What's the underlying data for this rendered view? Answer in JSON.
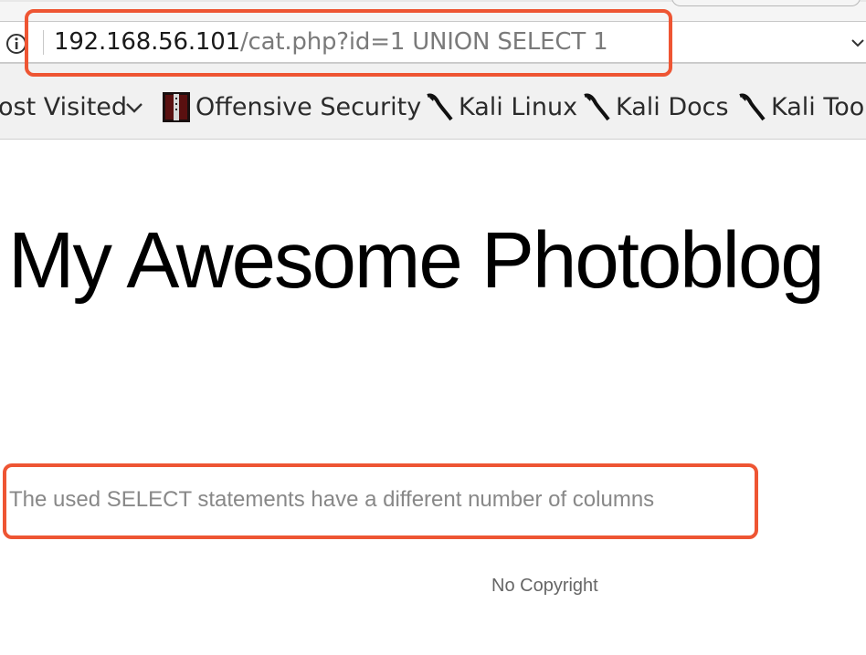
{
  "browser": {
    "url_host": "192.168.56.101",
    "url_path": "/cat.php?id=1 UNION SELECT 1",
    "bookmarks": [
      {
        "label": "ost Visited",
        "icon": "chevron-down-icon"
      },
      {
        "label": "Offensive Security",
        "icon": "offsec-favicon"
      },
      {
        "label": "Kali Linux",
        "icon": "kali-dragon-icon"
      },
      {
        "label": "Kali Docs",
        "icon": "kali-dragon-icon"
      },
      {
        "label": "Kali Too",
        "icon": "kali-dragon-icon"
      }
    ]
  },
  "page": {
    "title": "My Awesome Photoblog",
    "error_message": "The used SELECT statements have a different number of columns",
    "footer": "No Copyright"
  },
  "colors": {
    "highlight": "#ee5533",
    "title": "#000000",
    "error_text": "#888888"
  }
}
